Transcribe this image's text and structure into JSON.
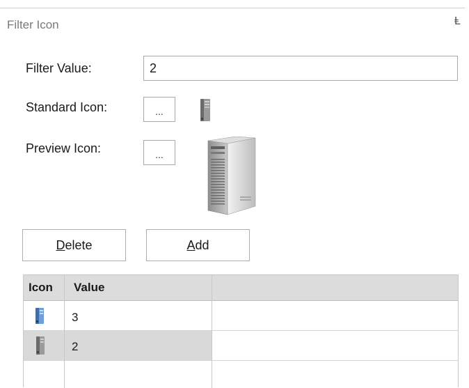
{
  "panel": {
    "title": "Filter Icon",
    "pin_glyph": "Ⱡ"
  },
  "form": {
    "filter_value_label": "Filter Value:",
    "filter_value": "2",
    "standard_icon_label": "Standard Icon:",
    "standard_icon_button": "...",
    "standard_icon": "server-tower-icon",
    "preview_icon_label": "Preview Icon:",
    "preview_icon_button": "...",
    "preview_icon": "server-tower-icon"
  },
  "buttons": {
    "delete_first": "D",
    "delete_rest": "elete",
    "add_first": "A",
    "add_rest": "dd"
  },
  "grid": {
    "columns": [
      "Icon",
      "Value"
    ],
    "rows": [
      {
        "icon": "server-tower-blue-icon",
        "value": "3",
        "selected": false
      },
      {
        "icon": "server-tower-icon",
        "value": "2",
        "selected": true
      }
    ]
  },
  "colors": {
    "header_bg": "#dcdcdc",
    "selected_row": "#d9d9d9",
    "border": "#a9a9a9"
  }
}
